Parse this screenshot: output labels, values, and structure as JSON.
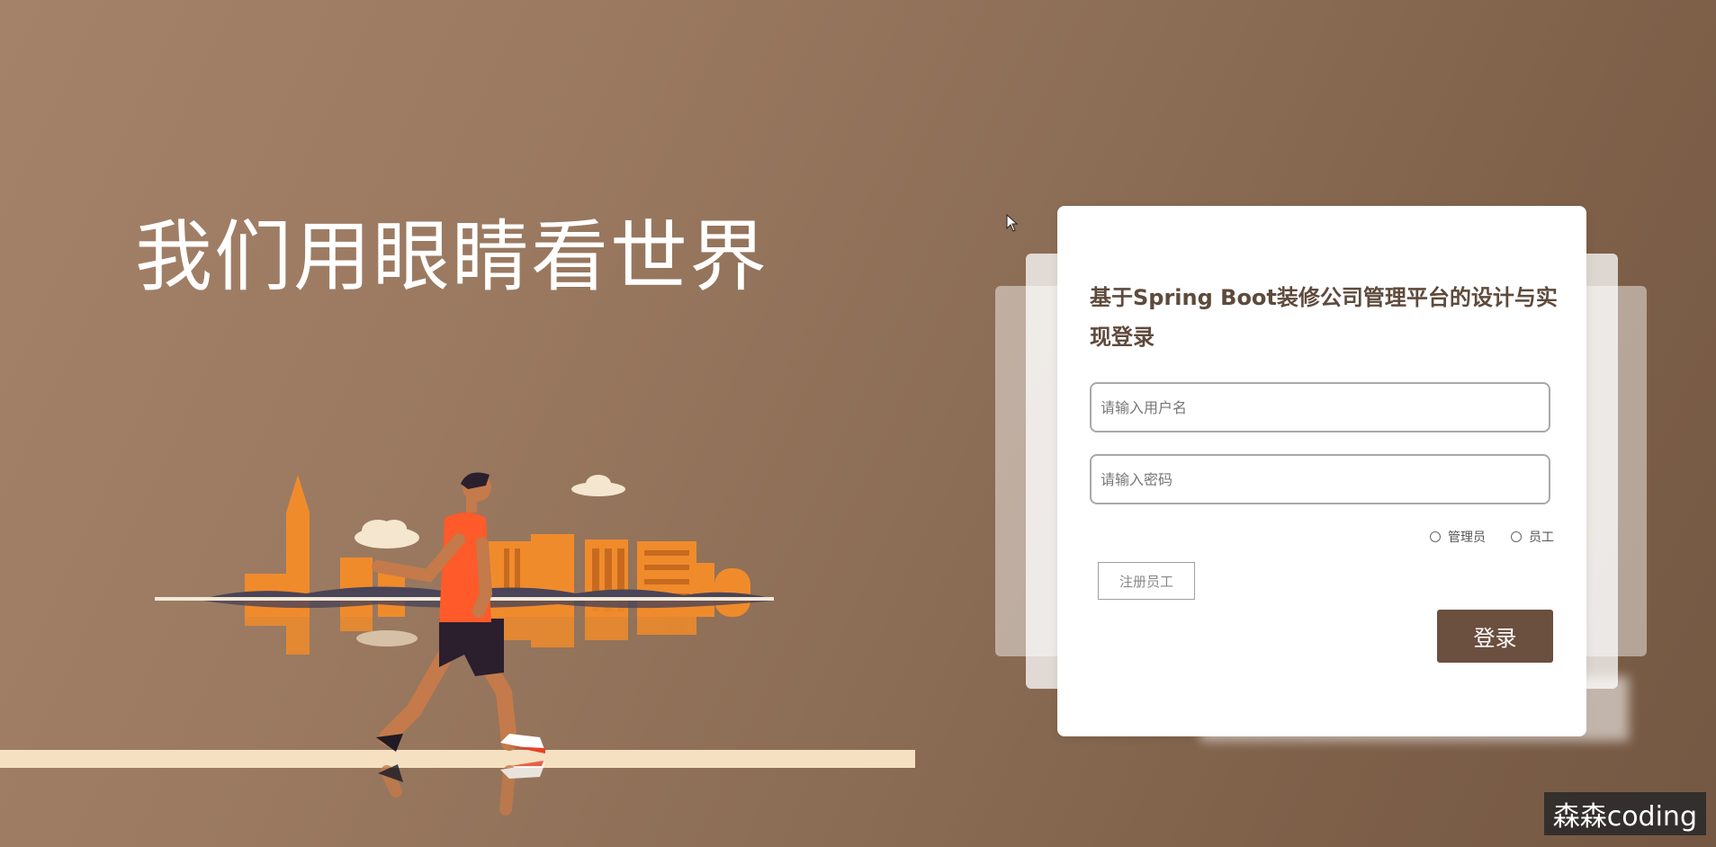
{
  "hero": {
    "slogan": "我们用眼睛看世界"
  },
  "login": {
    "title": "基于Spring Boot装修公司管理平台的设计与实现登录",
    "username_placeholder": "请输入用户名",
    "password_placeholder": "请输入密码",
    "roles": [
      {
        "label": "管理员"
      },
      {
        "label": "员工"
      }
    ],
    "register_label": "注册员工",
    "login_label": "登录"
  },
  "watermark": "森森coding",
  "colors": {
    "accent": "#6b4f3f",
    "title": "#5e4a3c",
    "background": "#8f6f57"
  }
}
